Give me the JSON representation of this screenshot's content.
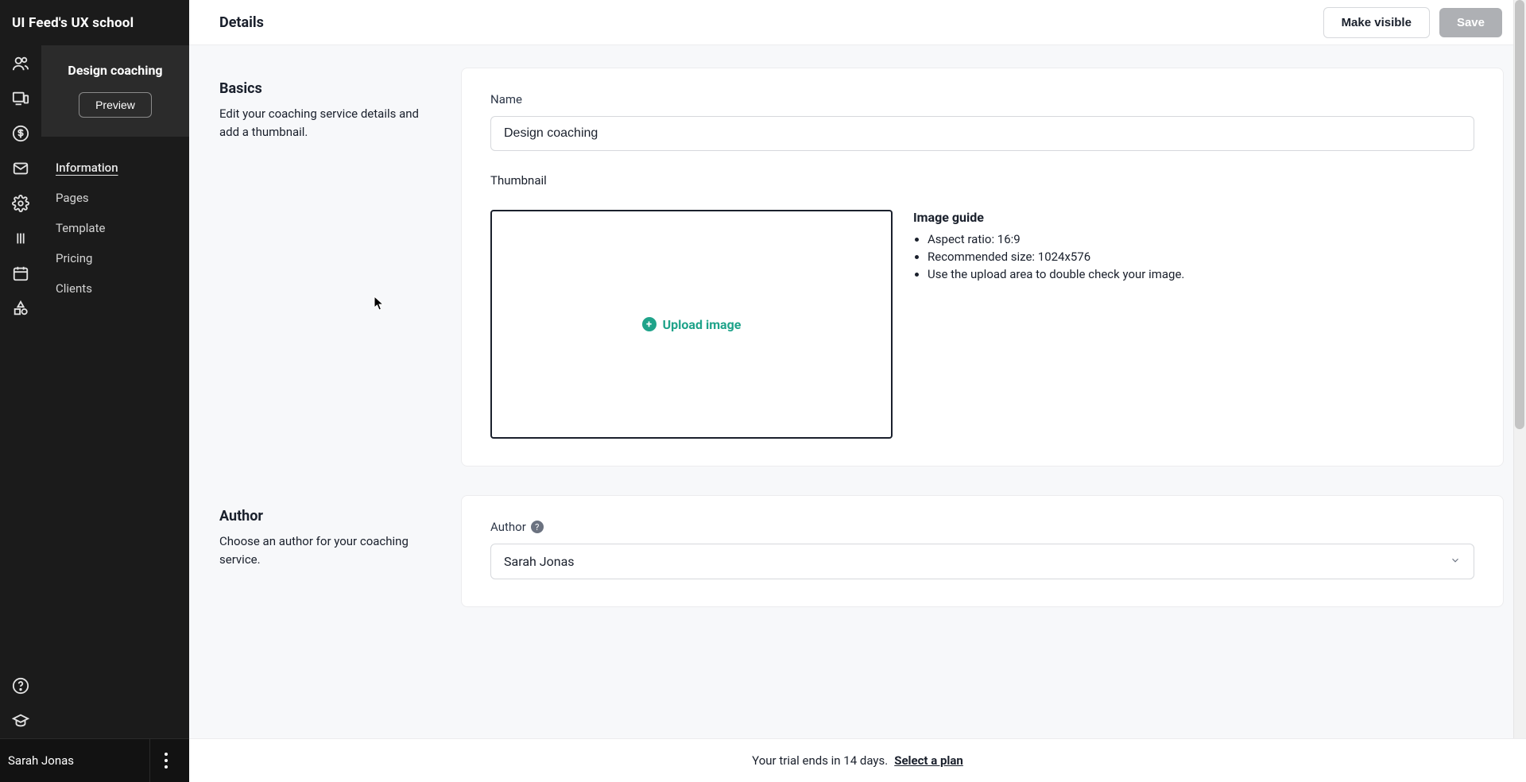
{
  "brand": "UI Feed's UX school",
  "course": {
    "title": "Design coaching",
    "preview_label": "Preview"
  },
  "side_nav": {
    "items": [
      {
        "label": "Information",
        "active": true
      },
      {
        "label": "Pages"
      },
      {
        "label": "Template"
      },
      {
        "label": "Pricing"
      },
      {
        "label": "Clients"
      }
    ]
  },
  "topbar": {
    "title": "Details",
    "make_visible_label": "Make visible",
    "save_label": "Save"
  },
  "sections": {
    "basics": {
      "heading": "Basics",
      "description": "Edit your coaching service details and add a thumbnail.",
      "name_label": "Name",
      "name_value": "Design coaching",
      "thumbnail_label": "Thumbnail",
      "upload_label": "Upload image",
      "guide": {
        "heading": "Image guide",
        "items": [
          "Aspect ratio: 16:9",
          "Recommended size: 1024x576",
          "Use the upload area to double check your image."
        ]
      }
    },
    "author": {
      "heading": "Author",
      "description": "Choose an author for your coaching service.",
      "label": "Author",
      "selected": "Sarah Jonas"
    }
  },
  "footer": {
    "user": "Sarah Jonas",
    "trial_text": "Your trial ends in 14 days.",
    "select_plan": "Select a plan"
  }
}
